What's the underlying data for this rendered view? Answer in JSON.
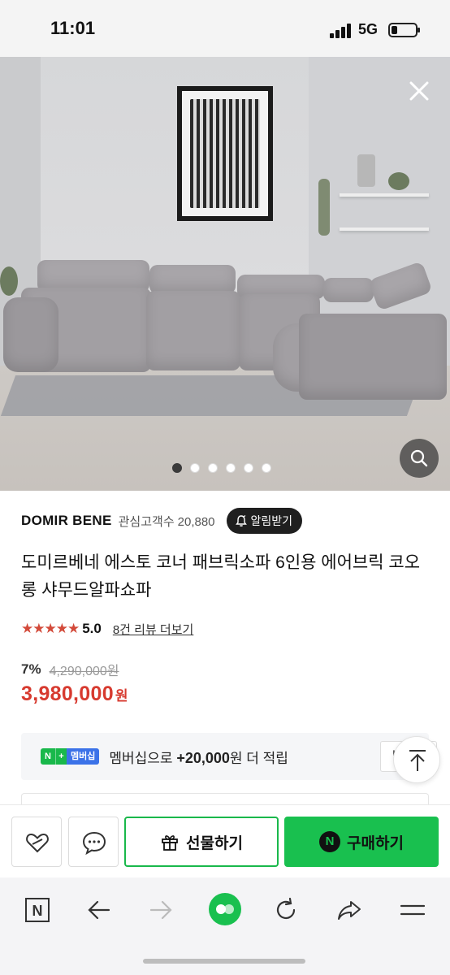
{
  "status_bar": {
    "time": "11:01",
    "network": "5G",
    "battery_level": 0.25
  },
  "gallery": {
    "image_count": 6,
    "active_index": 0,
    "close_icon": "close-icon",
    "zoom_icon": "search-icon"
  },
  "product": {
    "brand": "DOMIR BENE",
    "interest_label": "관심고객수",
    "interest_count": "20,880",
    "alarm_label": "알림받기",
    "title": "도미르베네 에스토 코너 패브릭소파 6인용 에어브릭 코오롱 샤무드알파쇼파",
    "stars": "★★★★★",
    "rating": "5.0",
    "review_link": "8건 리뷰 더보기",
    "discount": "7%",
    "original_price": "4,290,000원",
    "price": "3,980,000",
    "currency": "원"
  },
  "membership": {
    "badge_n": "N",
    "badge_plus": "+",
    "badge_text": "멤버십",
    "text_prefix": "멤버십으로 ",
    "points": "+20,000",
    "text_suffix": "원 더 적립",
    "receive_label": "받기"
  },
  "actions": {
    "gift_label": "선물하기",
    "buy_label": "구매하기",
    "buy_badge": "N"
  },
  "browser": {
    "home_badge": "N"
  },
  "colors": {
    "accent_green": "#19c04f",
    "price_red": "#d73a2f",
    "star_red": "#d34a3a"
  }
}
